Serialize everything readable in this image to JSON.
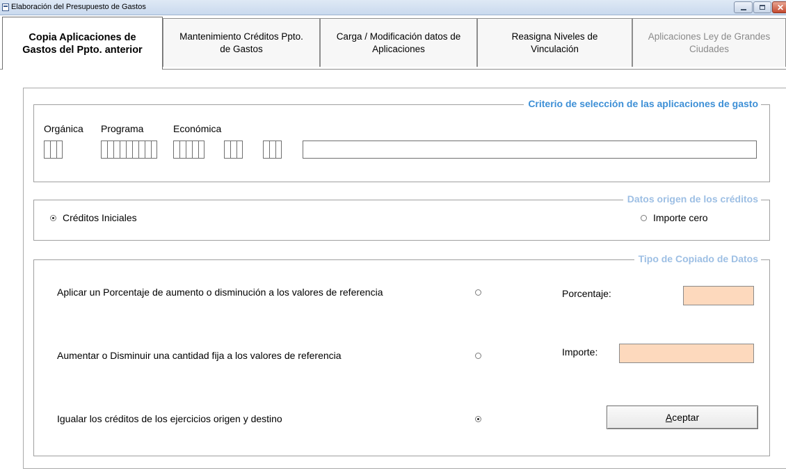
{
  "window": {
    "title": "Elaboración del Presupuesto de Gastos",
    "icon": "app-icon"
  },
  "tabs": [
    {
      "label": "Copia Aplicaciones de\nGastos del Ppto. anterior",
      "active": true,
      "enabled": true
    },
    {
      "label": "Mantenimiento Créditos Ppto.\nde Gastos",
      "active": false,
      "enabled": true
    },
    {
      "label": "Carga / Modificación datos de\nAplicaciones",
      "active": false,
      "enabled": true
    },
    {
      "label": "Reasigna Niveles de\nVinculación",
      "active": false,
      "enabled": true
    },
    {
      "label": "Aplicaciones Ley de Grandes\nCiudades",
      "active": false,
      "enabled": false
    }
  ],
  "criterio": {
    "title": "Criterio de selección de las aplicaciones de gasto",
    "organica_label": "Orgánica",
    "programa_label": "Programa",
    "economica_label": "Económica",
    "description_value": ""
  },
  "origen": {
    "title": "Datos origen de los créditos",
    "option_iniciales": "Créditos Iniciales",
    "option_cero": "Importe cero",
    "selected": "Créditos Iniciales"
  },
  "copiado": {
    "title": "Tipo de Copiado de Datos",
    "option_porcentaje": "Aplicar un Porcentaje de aumento o disminución a los valores de referencia",
    "porcentaje_label": "Porcentaje:",
    "porcentaje_value": "",
    "option_cantidad": "Aumentar o Disminuir una cantidad fija a los valores de referencia",
    "importe_label": "Importe:",
    "importe_value": "",
    "option_igualar": "Igualar los créditos de los ejercicios origen y destino",
    "selected": "Igualar los créditos de los ejercicios origen y destino"
  },
  "buttons": {
    "aceptar_accel": "A",
    "aceptar_rest": "ceptar"
  },
  "colors": {
    "group_title": "#3d8fd6",
    "input_highlight": "#fdd9bd"
  }
}
